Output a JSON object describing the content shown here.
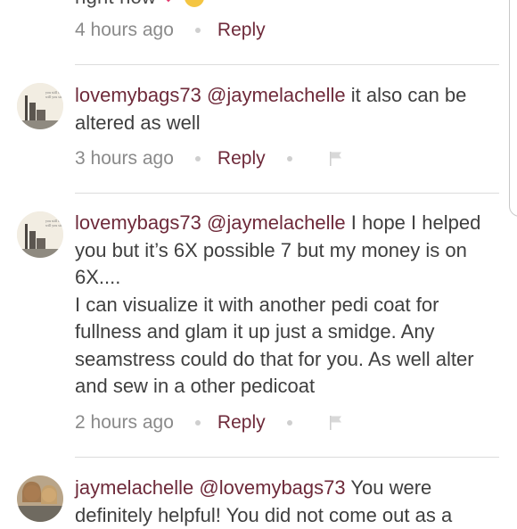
{
  "top": {
    "fragment": "right now",
    "meta": {
      "time": "4 hours ago",
      "reply": "Reply"
    }
  },
  "comments": [
    {
      "username": "lovemybags73",
      "mention": "@jaymelachelle",
      "lines": [
        "it also can be",
        "altered as well"
      ],
      "time": "3 hours ago",
      "reply": "Reply"
    },
    {
      "username": "lovemybags73",
      "mention": "@jaymelachelle",
      "lines": [
        "I hope I helped",
        "you but it’s 6X possible 7 but my money is on",
        "6X....",
        "I can visualize it with another pedi coat for",
        "fullness and glam it up just a smidge. Any",
        "seamstress could do that for you. As well alter",
        "and sew in a other pedicoat"
      ],
      "time": "2 hours ago",
      "reply": "Reply"
    },
    {
      "username": "jaymelachelle",
      "mention": "@lovemybags73",
      "lines": [
        "You were",
        "definitely helpful! You did not come out as a"
      ]
    }
  ],
  "colors": {
    "accent": "#6e2a3a",
    "meta": "#8a8a8a",
    "text": "#3f3f3f",
    "heart": "#e0356b"
  }
}
